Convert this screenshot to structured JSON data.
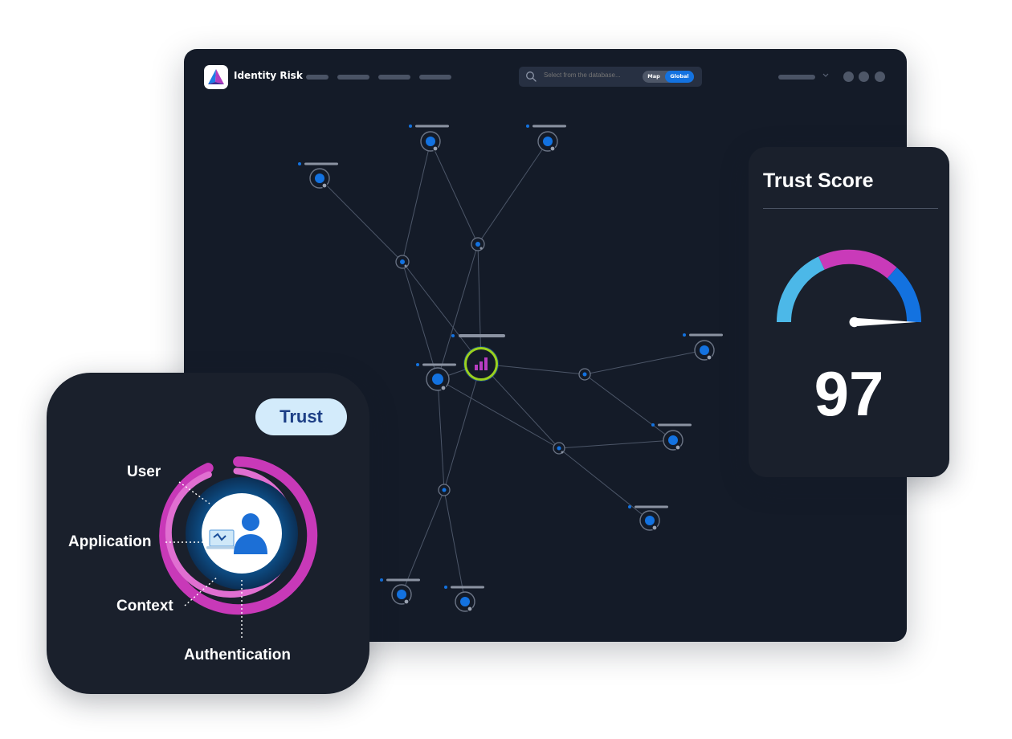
{
  "app": {
    "title": "Identity Risk"
  },
  "search": {
    "placeholder": "Select from the database...",
    "toggle": {
      "options": [
        "Map",
        "Global"
      ],
      "selected": "Global"
    }
  },
  "colors": {
    "window_bg": "#141b28",
    "card_bg": "#1a202c",
    "accent_blue": "#1372e0",
    "magenta": "#c93ab9",
    "light_blue": "#4cb8e8",
    "trust_pill_bg": "#d3ebfb",
    "trust_pill_text": "#1d3f86",
    "hub_ring": "#9ad11f"
  },
  "score_card": {
    "title": "Trust Score",
    "value": "97",
    "gauge_segments": [
      "light-blue",
      "magenta",
      "blue"
    ]
  },
  "trust_card": {
    "badge": "Trust",
    "factors": [
      "User",
      "Application",
      "Context",
      "Authentication"
    ]
  },
  "icons": {
    "logo": "prism-logo-icon",
    "search": "search-icon",
    "chevron": "chevron-down-icon",
    "hub": "bar-chart-icon",
    "user": "user-icon",
    "application": "laptop-icon"
  }
}
